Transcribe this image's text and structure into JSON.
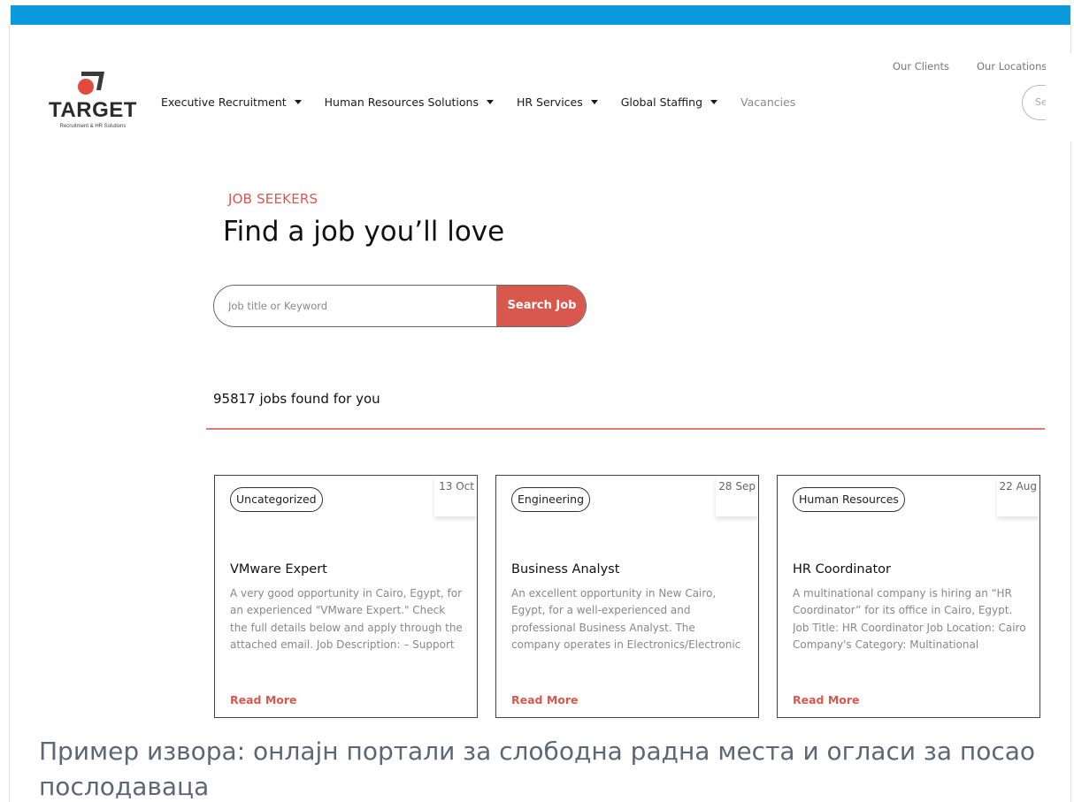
{
  "colors": {
    "topbar": "#0a9add",
    "accent": "#d9584e"
  },
  "logo": {
    "word": "TARGET",
    "tagline": "Recruitment & HR Solutions"
  },
  "nav": {
    "items": [
      {
        "label": "Executive Recruitment"
      },
      {
        "label": "Human Resources Solutions"
      },
      {
        "label": "HR Services"
      },
      {
        "label": "Global Staffing"
      },
      {
        "label": "Vacancies"
      }
    ]
  },
  "toplinks": {
    "clients": "Our Clients",
    "locations": "Our Locations"
  },
  "header_search": {
    "placeholder": "Se"
  },
  "hero": {
    "eyebrow": "JOB SEEKERS",
    "title": "Find a job you’ll love",
    "search_placeholder": "Job title or Keyword",
    "search_button": "Search Job"
  },
  "results": {
    "count_text": "95817 jobs found for you"
  },
  "jobs": [
    {
      "category": "Uncategorized",
      "date": "13 Oct",
      "title": "VMware Expert",
      "description": "A very good opportunity in Cairo, Egypt, for an experienced \"VMware Expert.\" Check the full details below and apply through the attached email. Job Description: – Support VMware products deployed",
      "read_more": "Read More"
    },
    {
      "category": "Engineering",
      "date": "28 Sep",
      "title": "Business Analyst",
      "description": "An excellent opportunity in New Cairo, Egypt, for a well-experienced and professional Business Analyst. The company operates in Electronics/Electronic Manufacturing industry. Check the full details below and apply through the",
      "read_more": "Read More"
    },
    {
      "category": "Human Resources",
      "date": "22 Aug",
      "title": "HR Coordinator",
      "description": "A multinational company is hiring an “HR Coordinator” for its office in Cairo, Egypt. Job Title: HR Coordinator Job Location: Cairo Company's Category: Multinational Company   About the HR Coordinator",
      "read_more": "Read More"
    }
  ],
  "caption": "Пример извора: онлајн портали за слободна радна места и огласи за посао послодаваца"
}
